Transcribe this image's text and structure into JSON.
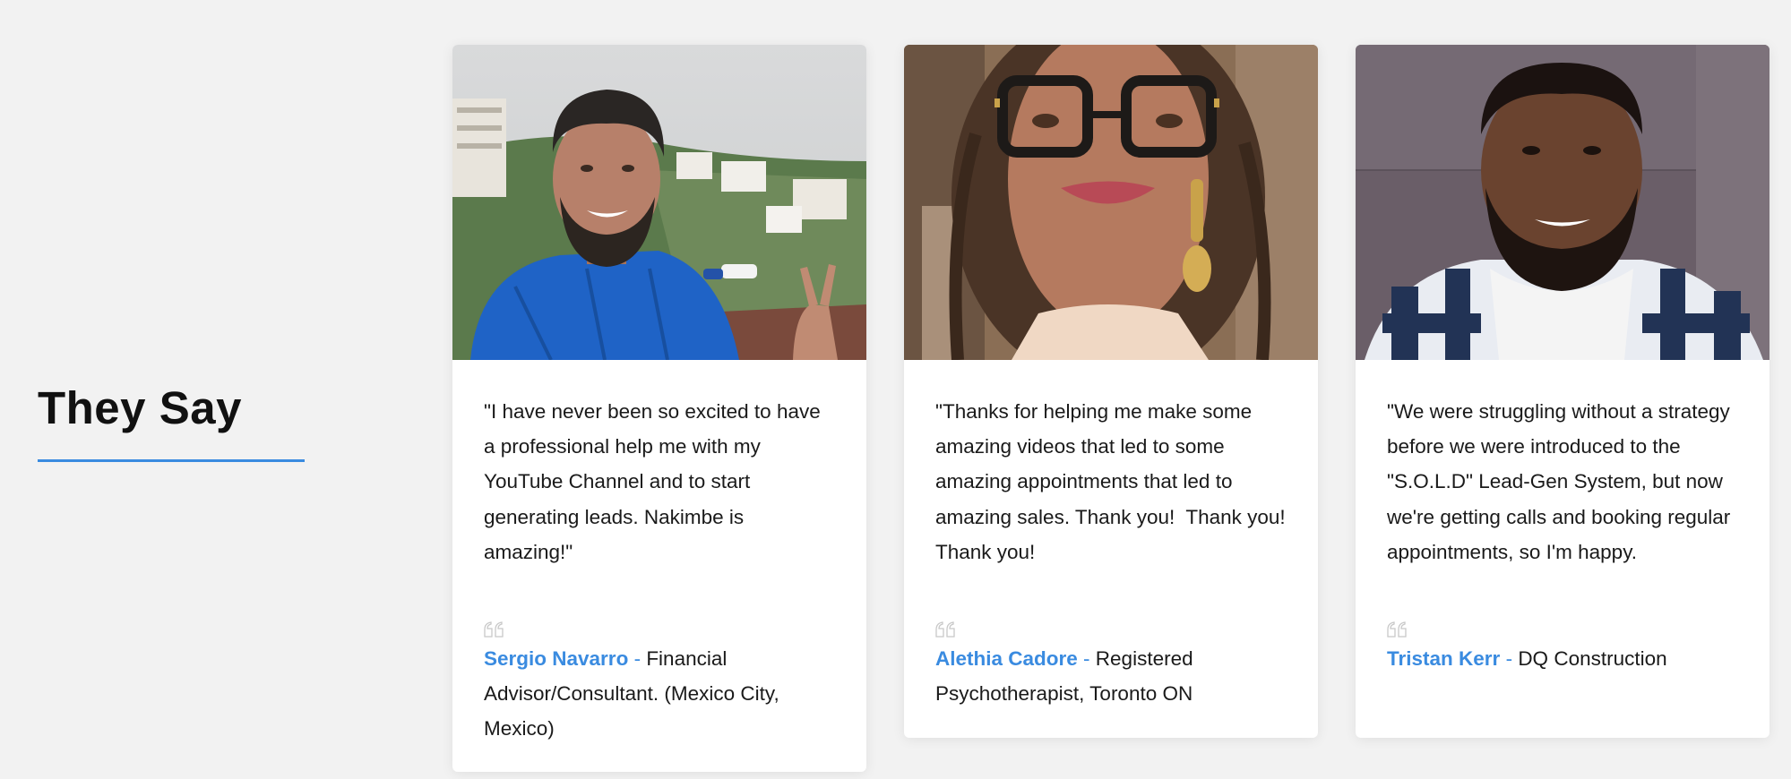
{
  "section": {
    "title": "They Say"
  },
  "colors": {
    "accent": "#3a8be0",
    "background": "#f2f2f2",
    "card": "#ffffff",
    "text": "#1a1a1a"
  },
  "testimonials": [
    {
      "photo_icon": "person-photo",
      "quote": "\"I have never been so excited to have a professional help me with my YouTube Channel and to start generating leads. Nakimbe is amazing!\"",
      "name": "Sergio Navarro",
      "separator": " - ",
      "role": "Financial Advisor/Consultant. (Mexico City, Mexico)"
    },
    {
      "photo_icon": "person-photo",
      "quote": "\"Thanks for helping me make some amazing videos that led to some amazing appointments that led to amazing sales. Thank you!  Thank you! Thank you!",
      "name": "Alethia Cadore",
      "separator": " - ",
      "role": "Registered Psychotherapist, Toronto ON"
    },
    {
      "photo_icon": "person-photo",
      "quote": "\"We were struggling without a strategy before we were introduced to the \"S.O.L.D\" Lead-Gen System, but now we're getting calls and booking regular appointments, so I'm happy.",
      "name": "Tristan Kerr",
      "separator": " - ",
      "role": "DQ Construction"
    }
  ]
}
